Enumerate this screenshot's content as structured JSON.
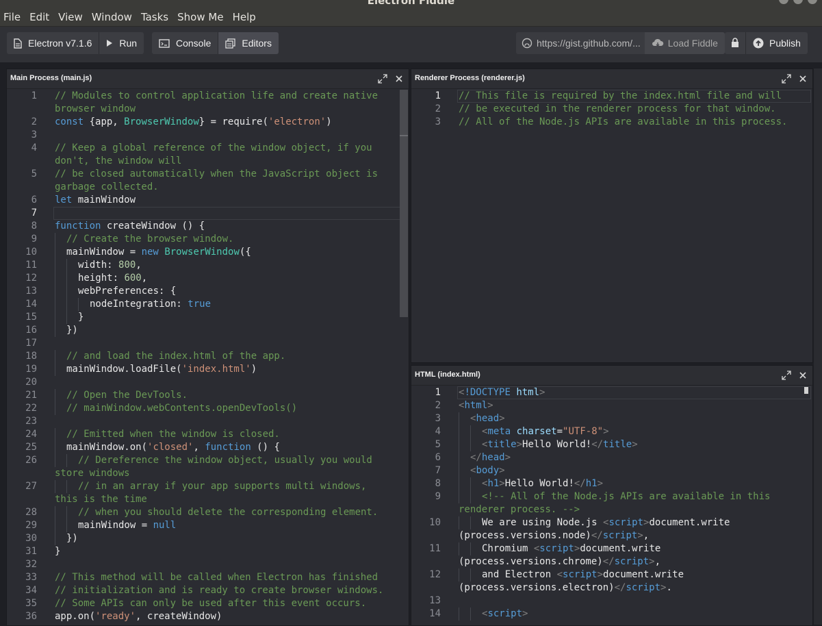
{
  "window": {
    "title": "Electron Fiddle"
  },
  "menu": [
    "File",
    "Edit",
    "View",
    "Window",
    "Tasks",
    "Show Me",
    "Help"
  ],
  "toolbar": {
    "version_label": "Electron v7.1.6",
    "run_label": "Run",
    "console_label": "Console",
    "editors_label": "Editors",
    "gist_value": "https://gist.github.com/...",
    "load_label": "Load Fiddle",
    "publish_label": "Publish"
  },
  "panels": {
    "main": {
      "title": "Main Process (main.js)",
      "lines": [
        {
          "n": "1",
          "tokens": [
            {
              "c": "c",
              "t": "// Modules to control application life and create native"
            }
          ]
        },
        {
          "n": "",
          "tokens": [
            {
              "c": "c",
              "t": "browser window"
            }
          ]
        },
        {
          "n": "2",
          "tokens": [
            {
              "c": "k",
              "t": "const"
            },
            {
              "t": " {app, "
            },
            {
              "c": "g",
              "t": "BrowserWindow"
            },
            {
              "t": "} = require("
            },
            {
              "c": "s",
              "t": "'electron'"
            },
            {
              "t": ")"
            }
          ]
        },
        {
          "n": "3",
          "tokens": []
        },
        {
          "n": "4",
          "tokens": [
            {
              "c": "c",
              "t": "// Keep a global reference of the window object, if you"
            }
          ]
        },
        {
          "n": "",
          "tokens": [
            {
              "c": "c",
              "t": "don't, the window will"
            }
          ]
        },
        {
          "n": "5",
          "tokens": [
            {
              "c": "c",
              "t": "// be closed automatically when the JavaScript object is"
            }
          ]
        },
        {
          "n": "",
          "tokens": [
            {
              "c": "c",
              "t": "garbage collected."
            }
          ]
        },
        {
          "n": "6",
          "tokens": [
            {
              "c": "k",
              "t": "let"
            },
            {
              "t": " mainWindow"
            }
          ]
        },
        {
          "n": "7",
          "tokens": []
        },
        {
          "n": "8",
          "tokens": [
            {
              "c": "k",
              "t": "function"
            },
            {
              "t": " createWindow () {"
            }
          ]
        },
        {
          "n": "9",
          "indent": 1,
          "tokens": [
            {
              "c": "c",
              "t": "// Create the browser window."
            }
          ]
        },
        {
          "n": "10",
          "indent": 1,
          "tokens": [
            {
              "t": "mainWindow = "
            },
            {
              "c": "k",
              "t": "new"
            },
            {
              "t": " "
            },
            {
              "c": "g",
              "t": "BrowserWindow"
            },
            {
              "t": "({"
            }
          ]
        },
        {
          "n": "11",
          "indent": 2,
          "tokens": [
            {
              "t": "width: "
            },
            {
              "c": "n",
              "t": "800"
            },
            {
              "t": ","
            }
          ]
        },
        {
          "n": "12",
          "indent": 2,
          "tokens": [
            {
              "t": "height: "
            },
            {
              "c": "n",
              "t": "600"
            },
            {
              "t": ","
            }
          ]
        },
        {
          "n": "13",
          "indent": 2,
          "tokens": [
            {
              "t": "webPreferences: {"
            }
          ]
        },
        {
          "n": "14",
          "indent": 3,
          "tokens": [
            {
              "t": "nodeIntegration: "
            },
            {
              "c": "k",
              "t": "true"
            }
          ]
        },
        {
          "n": "15",
          "indent": 2,
          "tokens": [
            {
              "t": "}"
            }
          ]
        },
        {
          "n": "16",
          "indent": 1,
          "tokens": [
            {
              "t": "})"
            }
          ]
        },
        {
          "n": "17",
          "tokens": []
        },
        {
          "n": "18",
          "indent": 1,
          "tokens": [
            {
              "c": "c",
              "t": "// and load the index.html of the app."
            }
          ]
        },
        {
          "n": "19",
          "indent": 1,
          "tokens": [
            {
              "t": "mainWindow.loadFile("
            },
            {
              "c": "s",
              "t": "'index.html'"
            },
            {
              "t": ")"
            }
          ]
        },
        {
          "n": "20",
          "tokens": []
        },
        {
          "n": "21",
          "indent": 1,
          "tokens": [
            {
              "c": "c",
              "t": "// Open the DevTools."
            }
          ]
        },
        {
          "n": "22",
          "indent": 1,
          "tokens": [
            {
              "c": "c",
              "t": "// mainWindow.webContents.openDevTools()"
            }
          ]
        },
        {
          "n": "23",
          "tokens": []
        },
        {
          "n": "24",
          "indent": 1,
          "tokens": [
            {
              "c": "c",
              "t": "// Emitted when the window is closed."
            }
          ]
        },
        {
          "n": "25",
          "indent": 1,
          "tokens": [
            {
              "t": "mainWindow.on("
            },
            {
              "c": "s",
              "t": "'closed'"
            },
            {
              "t": ", "
            },
            {
              "c": "k",
              "t": "function"
            },
            {
              "t": " () {"
            }
          ]
        },
        {
          "n": "26",
          "indent": 2,
          "tokens": [
            {
              "c": "c",
              "t": "// Dereference the window object, usually you would"
            }
          ]
        },
        {
          "n": "",
          "tokens": [
            {
              "c": "c",
              "t": "store windows"
            }
          ]
        },
        {
          "n": "27",
          "indent": 2,
          "tokens": [
            {
              "c": "c",
              "t": "// in an array if your app supports multi windows,"
            }
          ]
        },
        {
          "n": "",
          "tokens": [
            {
              "c": "c",
              "t": "this is the time"
            }
          ]
        },
        {
          "n": "28",
          "indent": 2,
          "tokens": [
            {
              "c": "c",
              "t": "// when you should delete the corresponding element."
            }
          ]
        },
        {
          "n": "29",
          "indent": 2,
          "tokens": [
            {
              "t": "mainWindow = "
            },
            {
              "c": "k",
              "t": "null"
            }
          ]
        },
        {
          "n": "30",
          "indent": 1,
          "tokens": [
            {
              "t": "})"
            }
          ]
        },
        {
          "n": "31",
          "tokens": [
            {
              "t": "}"
            }
          ]
        },
        {
          "n": "32",
          "tokens": []
        },
        {
          "n": "33",
          "tokens": [
            {
              "c": "c",
              "t": "// This method will be called when Electron has finished"
            }
          ]
        },
        {
          "n": "34",
          "tokens": [
            {
              "c": "c",
              "t": "// initialization and is ready to create browser windows."
            }
          ]
        },
        {
          "n": "35",
          "tokens": [
            {
              "c": "c",
              "t": "// Some APIs can only be used after this event occurs."
            }
          ]
        },
        {
          "n": "36",
          "tokens": [
            {
              "t": "app.on("
            },
            {
              "c": "s",
              "t": "'ready'"
            },
            {
              "t": ", createWindow)"
            }
          ]
        }
      ]
    },
    "renderer": {
      "title": "Renderer Process (renderer.js)",
      "lines": [
        {
          "n": "1",
          "tokens": [
            {
              "c": "c",
              "t": "// This file is required by the index.html file and will"
            }
          ]
        },
        {
          "n": "2",
          "tokens": [
            {
              "c": "c",
              "t": "// be executed in the renderer process for that window."
            }
          ]
        },
        {
          "n": "3",
          "tokens": [
            {
              "c": "c",
              "t": "// All of the Node.js APIs are available in this process."
            }
          ]
        }
      ]
    },
    "html": {
      "title": "HTML (index.html)",
      "lines": [
        {
          "n": "1",
          "tokens": [
            {
              "c": "p",
              "t": "<"
            },
            {
              "c": "t",
              "t": "!DOCTYPE"
            },
            {
              "t": " "
            },
            {
              "c": "a",
              "t": "html"
            },
            {
              "c": "p",
              "t": ">"
            }
          ]
        },
        {
          "n": "2",
          "tokens": [
            {
              "c": "p",
              "t": "<"
            },
            {
              "c": "t",
              "t": "html"
            },
            {
              "c": "p",
              "t": ">"
            }
          ]
        },
        {
          "n": "3",
          "indent": 1,
          "tokens": [
            {
              "c": "p",
              "t": "<"
            },
            {
              "c": "t",
              "t": "head"
            },
            {
              "c": "p",
              "t": ">"
            }
          ]
        },
        {
          "n": "4",
          "indent": 2,
          "tokens": [
            {
              "c": "p",
              "t": "<"
            },
            {
              "c": "t",
              "t": "meta"
            },
            {
              "t": " "
            },
            {
              "c": "a",
              "t": "charset"
            },
            {
              "t": "="
            },
            {
              "c": "s",
              "t": "\"UTF-8\""
            },
            {
              "c": "p",
              "t": ">"
            }
          ]
        },
        {
          "n": "5",
          "indent": 2,
          "tokens": [
            {
              "c": "p",
              "t": "<"
            },
            {
              "c": "t",
              "t": "title"
            },
            {
              "c": "p",
              "t": ">"
            },
            {
              "t": "Hello World!"
            },
            {
              "c": "p",
              "t": "</"
            },
            {
              "c": "t",
              "t": "title"
            },
            {
              "c": "p",
              "t": ">"
            }
          ]
        },
        {
          "n": "6",
          "indent": 1,
          "tokens": [
            {
              "c": "p",
              "t": "</"
            },
            {
              "c": "t",
              "t": "head"
            },
            {
              "c": "p",
              "t": ">"
            }
          ]
        },
        {
          "n": "7",
          "indent": 1,
          "tokens": [
            {
              "c": "p",
              "t": "<"
            },
            {
              "c": "t",
              "t": "body"
            },
            {
              "c": "p",
              "t": ">"
            }
          ]
        },
        {
          "n": "8",
          "indent": 2,
          "tokens": [
            {
              "c": "p",
              "t": "<"
            },
            {
              "c": "t",
              "t": "h1"
            },
            {
              "c": "p",
              "t": ">"
            },
            {
              "t": "Hello World!"
            },
            {
              "c": "p",
              "t": "</"
            },
            {
              "c": "t",
              "t": "h1"
            },
            {
              "c": "p",
              "t": ">"
            }
          ]
        },
        {
          "n": "9",
          "indent": 2,
          "tokens": [
            {
              "c": "c",
              "t": "<!-- All of the Node.js APIs are available in this"
            }
          ]
        },
        {
          "n": "",
          "tokens": [
            {
              "c": "c",
              "t": "renderer process. -->"
            }
          ]
        },
        {
          "n": "10",
          "indent": 2,
          "tokens": [
            {
              "t": "We are using Node.js "
            },
            {
              "c": "p",
              "t": "<"
            },
            {
              "c": "t",
              "t": "script"
            },
            {
              "c": "p",
              "t": ">"
            },
            {
              "t": "document.write"
            }
          ]
        },
        {
          "n": "",
          "tokens": [
            {
              "t": "(process.versions.node)"
            },
            {
              "c": "p",
              "t": "</"
            },
            {
              "c": "t",
              "t": "script"
            },
            {
              "c": "p",
              "t": ">"
            },
            {
              "t": ","
            }
          ]
        },
        {
          "n": "11",
          "indent": 2,
          "tokens": [
            {
              "t": "Chromium "
            },
            {
              "c": "p",
              "t": "<"
            },
            {
              "c": "t",
              "t": "script"
            },
            {
              "c": "p",
              "t": ">"
            },
            {
              "t": "document.write"
            }
          ]
        },
        {
          "n": "",
          "tokens": [
            {
              "t": "(process.versions.chrome)"
            },
            {
              "c": "p",
              "t": "</"
            },
            {
              "c": "t",
              "t": "script"
            },
            {
              "c": "p",
              "t": ">"
            },
            {
              "t": ","
            }
          ]
        },
        {
          "n": "12",
          "indent": 2,
          "tokens": [
            {
              "t": "and Electron "
            },
            {
              "c": "p",
              "t": "<"
            },
            {
              "c": "t",
              "t": "script"
            },
            {
              "c": "p",
              "t": ">"
            },
            {
              "t": "document.write"
            }
          ]
        },
        {
          "n": "",
          "tokens": [
            {
              "t": "(process.versions.electron)"
            },
            {
              "c": "p",
              "t": "</"
            },
            {
              "c": "t",
              "t": "script"
            },
            {
              "c": "p",
              "t": ">"
            },
            {
              "t": "."
            }
          ]
        },
        {
          "n": "13",
          "tokens": []
        },
        {
          "n": "14",
          "indent": 2,
          "tokens": [
            {
              "c": "p",
              "t": "<"
            },
            {
              "c": "t",
              "t": "script"
            },
            {
              "c": "p",
              "t": ">"
            }
          ]
        }
      ]
    }
  }
}
